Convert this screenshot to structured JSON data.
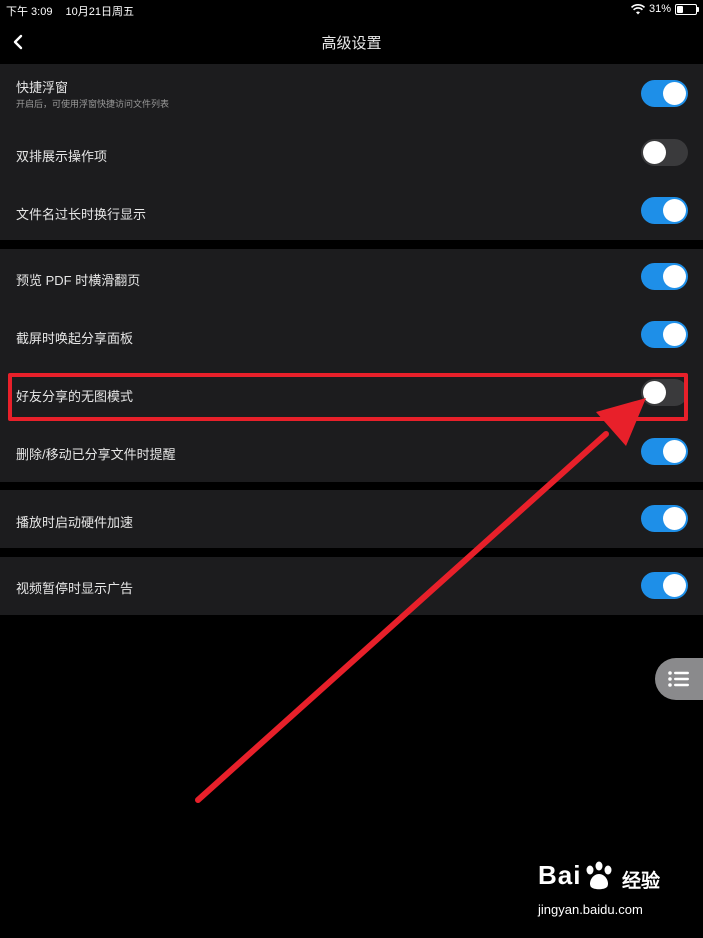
{
  "status_bar": {
    "time": "下午 3:09",
    "date": "10月21日周五",
    "battery_percent_text": "31%",
    "battery_level": 0.31,
    "wifi_icon": "wifi-icon"
  },
  "nav": {
    "back_icon": "chevron-left-icon",
    "title": "高级设置"
  },
  "groups": [
    {
      "rows": [
        {
          "label": "快捷浮窗",
          "sublabel": "开启后，可使用浮窗快捷访问文件列表",
          "on": true
        },
        {
          "label": "双排展示操作项",
          "on": false
        },
        {
          "label": "文件名过长时换行显示",
          "on": true
        }
      ]
    },
    {
      "rows": [
        {
          "label": "预览 PDF 时横滑翻页",
          "on": true
        },
        {
          "label": "截屏时唤起分享面板",
          "on": true
        },
        {
          "label": "好友分享的无图模式",
          "on": false,
          "highlighted": true
        },
        {
          "label": "删除/移动已分享文件时提醒",
          "on": true
        }
      ]
    },
    {
      "rows": [
        {
          "label": "播放时启动硬件加速",
          "on": true
        }
      ]
    },
    {
      "rows": [
        {
          "label": "视频暂停时显示广告",
          "on": true
        }
      ]
    }
  ],
  "floating_button": {
    "icon": "list-icon"
  },
  "watermark": {
    "logo_left": "Bai",
    "logo_right": "经验",
    "url": "jingyan.baidu.com"
  },
  "colors": {
    "toggle_on": "#1e8fe8",
    "toggle_off": "#3a3a3c",
    "annotation_red": "#e8202a"
  }
}
